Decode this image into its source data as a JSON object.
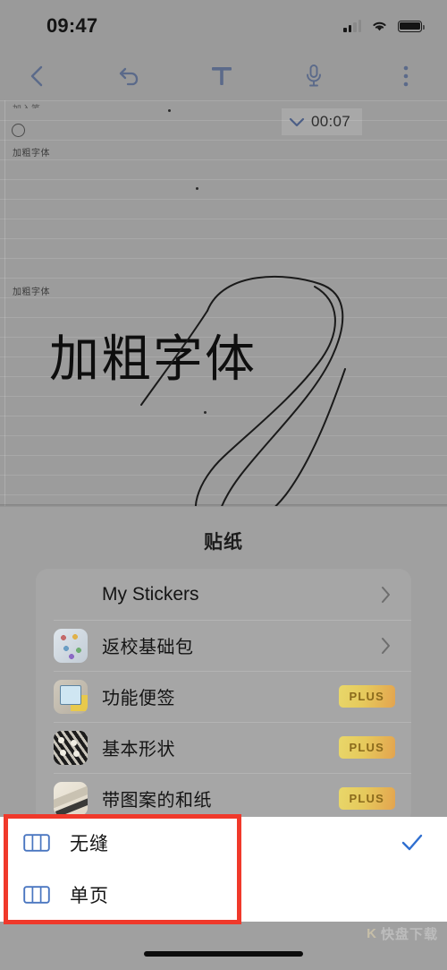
{
  "status_bar": {
    "time": "09:47",
    "signal_icon": "cellular-signal-icon",
    "wifi_icon": "wifi-icon",
    "battery_icon": "battery-full-icon"
  },
  "toolbar": {
    "back_icon": "chevron-left-icon",
    "undo_icon": "undo-arrow-icon",
    "text_icon": "text-tool-icon",
    "mic_icon": "microphone-icon",
    "more_icon": "more-vertical-icon",
    "accent_color": "#5b6a8a"
  },
  "note": {
    "clipped_top_text": "加入笔",
    "small_label_1": "加粗字体",
    "small_label_2": "加粗字体",
    "big_text": "加粗字体",
    "recording": {
      "time": "00:07",
      "chevron_icon": "chevron-down-icon"
    },
    "bullet_icon": "circle-bullet-icon"
  },
  "sticker_panel": {
    "title": "贴纸",
    "items": [
      {
        "label": "My Stickers",
        "thumb": "none",
        "accessory": "chevron-right-icon"
      },
      {
        "label": "返校基础包",
        "thumb": "back-to-school-stickers-thumb",
        "accessory": "chevron-right-icon"
      },
      {
        "label": "功能便签",
        "thumb": "sticky-notes-thumb",
        "accessory": "PLUS"
      },
      {
        "label": "基本形状",
        "thumb": "basic-shapes-thumb",
        "accessory": "PLUS"
      },
      {
        "label": "带图案的和纸",
        "thumb": "patterned-washi-thumb",
        "accessory": "PLUS"
      }
    ],
    "plus_badge_label": "PLUS",
    "plus_badge_color": "#e3a44f"
  },
  "popup_menu": {
    "items": [
      {
        "label": "无缝",
        "icon": "page-layout-icon",
        "checked": true
      },
      {
        "label": "单页",
        "icon": "page-layout-icon",
        "checked": false
      }
    ],
    "check_icon": "checkmark-icon",
    "check_color": "#2f6fd0",
    "highlight_color": "#f0392b"
  },
  "watermark": {
    "mark": "K",
    "text": "快盘下载"
  }
}
